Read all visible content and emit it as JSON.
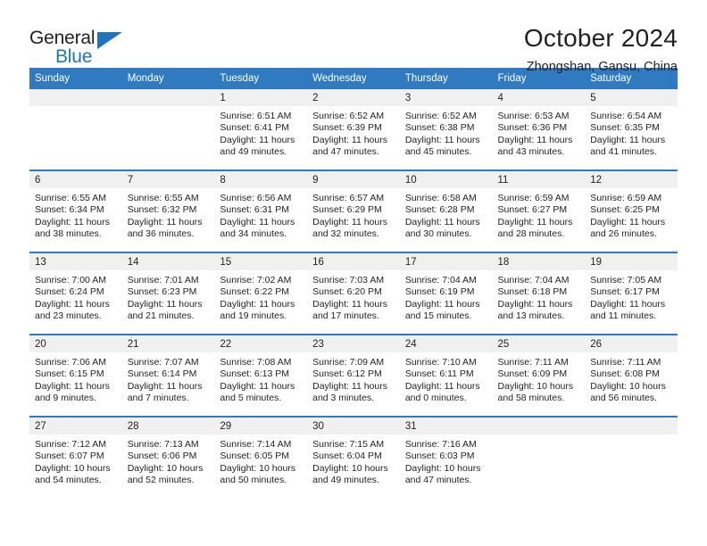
{
  "brand": {
    "name_part1": "General",
    "name_part2": "Blue",
    "triangle_color": "#1f74bd"
  },
  "header": {
    "title": "October 2024",
    "subtitle": "Zhongshan, Gansu, China"
  },
  "theme": {
    "header_bg": "#2f7ac0",
    "daynum_bg": "#f0f0f0",
    "text": "#231f20"
  },
  "weekday_headers": [
    "Sunday",
    "Monday",
    "Tuesday",
    "Wednesday",
    "Thursday",
    "Friday",
    "Saturday"
  ],
  "labels": {
    "sunrise_prefix": "Sunrise:",
    "sunset_prefix": "Sunset:",
    "daylight_prefix": "Daylight:"
  },
  "weeks": [
    [
      {
        "day": "",
        "sunrise": "",
        "sunset": "",
        "daylight_line1": "",
        "daylight_line2": ""
      },
      {
        "day": "",
        "sunrise": "",
        "sunset": "",
        "daylight_line1": "",
        "daylight_line2": ""
      },
      {
        "day": "1",
        "sunrise": "Sunrise: 6:51 AM",
        "sunset": "Sunset: 6:41 PM",
        "daylight_line1": "Daylight: 11 hours",
        "daylight_line2": "and 49 minutes."
      },
      {
        "day": "2",
        "sunrise": "Sunrise: 6:52 AM",
        "sunset": "Sunset: 6:39 PM",
        "daylight_line1": "Daylight: 11 hours",
        "daylight_line2": "and 47 minutes."
      },
      {
        "day": "3",
        "sunrise": "Sunrise: 6:52 AM",
        "sunset": "Sunset: 6:38 PM",
        "daylight_line1": "Daylight: 11 hours",
        "daylight_line2": "and 45 minutes."
      },
      {
        "day": "4",
        "sunrise": "Sunrise: 6:53 AM",
        "sunset": "Sunset: 6:36 PM",
        "daylight_line1": "Daylight: 11 hours",
        "daylight_line2": "and 43 minutes."
      },
      {
        "day": "5",
        "sunrise": "Sunrise: 6:54 AM",
        "sunset": "Sunset: 6:35 PM",
        "daylight_line1": "Daylight: 11 hours",
        "daylight_line2": "and 41 minutes."
      }
    ],
    [
      {
        "day": "6",
        "sunrise": "Sunrise: 6:55 AM",
        "sunset": "Sunset: 6:34 PM",
        "daylight_line1": "Daylight: 11 hours",
        "daylight_line2": "and 38 minutes."
      },
      {
        "day": "7",
        "sunrise": "Sunrise: 6:55 AM",
        "sunset": "Sunset: 6:32 PM",
        "daylight_line1": "Daylight: 11 hours",
        "daylight_line2": "and 36 minutes."
      },
      {
        "day": "8",
        "sunrise": "Sunrise: 6:56 AM",
        "sunset": "Sunset: 6:31 PM",
        "daylight_line1": "Daylight: 11 hours",
        "daylight_line2": "and 34 minutes."
      },
      {
        "day": "9",
        "sunrise": "Sunrise: 6:57 AM",
        "sunset": "Sunset: 6:29 PM",
        "daylight_line1": "Daylight: 11 hours",
        "daylight_line2": "and 32 minutes."
      },
      {
        "day": "10",
        "sunrise": "Sunrise: 6:58 AM",
        "sunset": "Sunset: 6:28 PM",
        "daylight_line1": "Daylight: 11 hours",
        "daylight_line2": "and 30 minutes."
      },
      {
        "day": "11",
        "sunrise": "Sunrise: 6:59 AM",
        "sunset": "Sunset: 6:27 PM",
        "daylight_line1": "Daylight: 11 hours",
        "daylight_line2": "and 28 minutes."
      },
      {
        "day": "12",
        "sunrise": "Sunrise: 6:59 AM",
        "sunset": "Sunset: 6:25 PM",
        "daylight_line1": "Daylight: 11 hours",
        "daylight_line2": "and 26 minutes."
      }
    ],
    [
      {
        "day": "13",
        "sunrise": "Sunrise: 7:00 AM",
        "sunset": "Sunset: 6:24 PM",
        "daylight_line1": "Daylight: 11 hours",
        "daylight_line2": "and 23 minutes."
      },
      {
        "day": "14",
        "sunrise": "Sunrise: 7:01 AM",
        "sunset": "Sunset: 6:23 PM",
        "daylight_line1": "Daylight: 11 hours",
        "daylight_line2": "and 21 minutes."
      },
      {
        "day": "15",
        "sunrise": "Sunrise: 7:02 AM",
        "sunset": "Sunset: 6:22 PM",
        "daylight_line1": "Daylight: 11 hours",
        "daylight_line2": "and 19 minutes."
      },
      {
        "day": "16",
        "sunrise": "Sunrise: 7:03 AM",
        "sunset": "Sunset: 6:20 PM",
        "daylight_line1": "Daylight: 11 hours",
        "daylight_line2": "and 17 minutes."
      },
      {
        "day": "17",
        "sunrise": "Sunrise: 7:04 AM",
        "sunset": "Sunset: 6:19 PM",
        "daylight_line1": "Daylight: 11 hours",
        "daylight_line2": "and 15 minutes."
      },
      {
        "day": "18",
        "sunrise": "Sunrise: 7:04 AM",
        "sunset": "Sunset: 6:18 PM",
        "daylight_line1": "Daylight: 11 hours",
        "daylight_line2": "and 13 minutes."
      },
      {
        "day": "19",
        "sunrise": "Sunrise: 7:05 AM",
        "sunset": "Sunset: 6:17 PM",
        "daylight_line1": "Daylight: 11 hours",
        "daylight_line2": "and 11 minutes."
      }
    ],
    [
      {
        "day": "20",
        "sunrise": "Sunrise: 7:06 AM",
        "sunset": "Sunset: 6:15 PM",
        "daylight_line1": "Daylight: 11 hours",
        "daylight_line2": "and 9 minutes."
      },
      {
        "day": "21",
        "sunrise": "Sunrise: 7:07 AM",
        "sunset": "Sunset: 6:14 PM",
        "daylight_line1": "Daylight: 11 hours",
        "daylight_line2": "and 7 minutes."
      },
      {
        "day": "22",
        "sunrise": "Sunrise: 7:08 AM",
        "sunset": "Sunset: 6:13 PM",
        "daylight_line1": "Daylight: 11 hours",
        "daylight_line2": "and 5 minutes."
      },
      {
        "day": "23",
        "sunrise": "Sunrise: 7:09 AM",
        "sunset": "Sunset: 6:12 PM",
        "daylight_line1": "Daylight: 11 hours",
        "daylight_line2": "and 3 minutes."
      },
      {
        "day": "24",
        "sunrise": "Sunrise: 7:10 AM",
        "sunset": "Sunset: 6:11 PM",
        "daylight_line1": "Daylight: 11 hours",
        "daylight_line2": "and 0 minutes."
      },
      {
        "day": "25",
        "sunrise": "Sunrise: 7:11 AM",
        "sunset": "Sunset: 6:09 PM",
        "daylight_line1": "Daylight: 10 hours",
        "daylight_line2": "and 58 minutes."
      },
      {
        "day": "26",
        "sunrise": "Sunrise: 7:11 AM",
        "sunset": "Sunset: 6:08 PM",
        "daylight_line1": "Daylight: 10 hours",
        "daylight_line2": "and 56 minutes."
      }
    ],
    [
      {
        "day": "27",
        "sunrise": "Sunrise: 7:12 AM",
        "sunset": "Sunset: 6:07 PM",
        "daylight_line1": "Daylight: 10 hours",
        "daylight_line2": "and 54 minutes."
      },
      {
        "day": "28",
        "sunrise": "Sunrise: 7:13 AM",
        "sunset": "Sunset: 6:06 PM",
        "daylight_line1": "Daylight: 10 hours",
        "daylight_line2": "and 52 minutes."
      },
      {
        "day": "29",
        "sunrise": "Sunrise: 7:14 AM",
        "sunset": "Sunset: 6:05 PM",
        "daylight_line1": "Daylight: 10 hours",
        "daylight_line2": "and 50 minutes."
      },
      {
        "day": "30",
        "sunrise": "Sunrise: 7:15 AM",
        "sunset": "Sunset: 6:04 PM",
        "daylight_line1": "Daylight: 10 hours",
        "daylight_line2": "and 49 minutes."
      },
      {
        "day": "31",
        "sunrise": "Sunrise: 7:16 AM",
        "sunset": "Sunset: 6:03 PM",
        "daylight_line1": "Daylight: 10 hours",
        "daylight_line2": "and 47 minutes."
      },
      {
        "day": "",
        "sunrise": "",
        "sunset": "",
        "daylight_line1": "",
        "daylight_line2": ""
      },
      {
        "day": "",
        "sunrise": "",
        "sunset": "",
        "daylight_line1": "",
        "daylight_line2": ""
      }
    ]
  ]
}
